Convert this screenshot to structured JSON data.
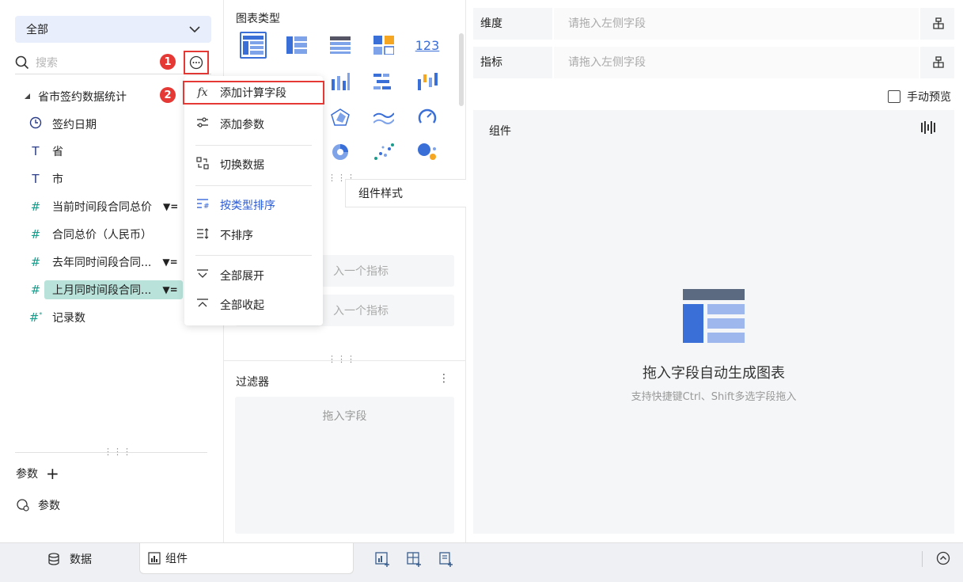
{
  "left": {
    "scope_select": "全部",
    "search_placeholder": "搜索",
    "badge1": "1",
    "badge2": "2",
    "tree_root": "省市签约数据统计",
    "fields": [
      {
        "label": "签约日期",
        "type": "date"
      },
      {
        "label": "省",
        "type": "text"
      },
      {
        "label": "市",
        "type": "text"
      },
      {
        "label": "当前时间段合同总价",
        "type": "number"
      },
      {
        "label": "合同总价（人民币）",
        "type": "number"
      },
      {
        "label": "去年同时间段合同...",
        "type": "number"
      },
      {
        "label": "上月同时间段合同...",
        "type": "number"
      },
      {
        "label": "记录数",
        "type": "number-calc"
      }
    ],
    "params_header": "参数",
    "params_item": "参数"
  },
  "menu": {
    "items": [
      {
        "label": "添加计算字段",
        "icon": "fx-icon"
      },
      {
        "label": "添加参数",
        "icon": "sliders-icon"
      },
      {
        "label": "切换数据",
        "icon": "swap-data-icon"
      },
      {
        "label": "按类型排序",
        "icon": "sort-type-icon"
      },
      {
        "label": "不排序",
        "icon": "no-sort-icon"
      },
      {
        "label": "全部展开",
        "icon": "expand-all-icon"
      },
      {
        "label": "全部收起",
        "icon": "collapse-all-icon"
      }
    ]
  },
  "middle": {
    "chart_types_title": "图表类型",
    "number_card": "123",
    "tab_style": "组件样式",
    "indicator_placeholder_1": "入一个指标",
    "indicator_placeholder_2": "入一个指标",
    "filter_title": "过滤器",
    "filter_placeholder": "拖入字段"
  },
  "right": {
    "dimension_label": "维度",
    "dimension_placeholder": "请拖入左侧字段",
    "metric_label": "指标",
    "metric_placeholder": "请拖入左侧字段",
    "manual_preview": "手动预览",
    "component_title": "组件",
    "empty_title": "拖入字段自动生成图表",
    "empty_sub": "支持快捷键Ctrl、Shift多选字段拖入"
  },
  "bottom": {
    "tab_data": "数据",
    "tab_component": "组件"
  },
  "colors": {
    "accent": "#2a5bd7",
    "highlight_red": "#e53935",
    "field_icon": "#1a9c8c",
    "selected_field_bg": "#b9e3da"
  }
}
